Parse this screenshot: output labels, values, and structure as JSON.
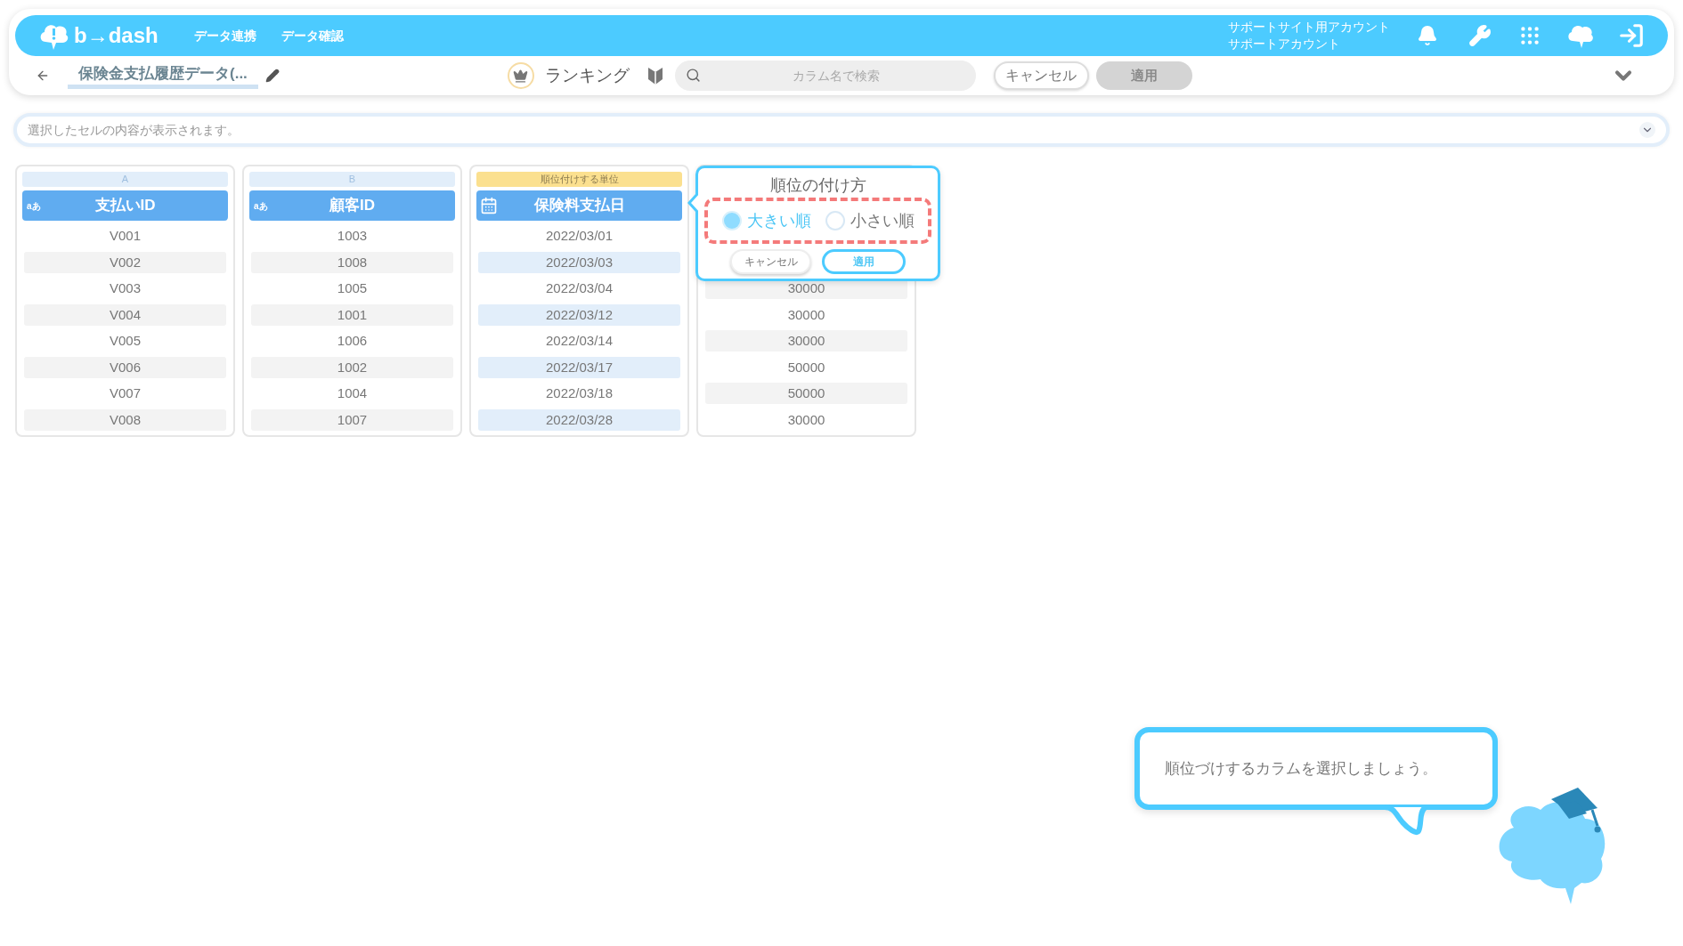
{
  "header": {
    "logo": "b→dash",
    "nav": [
      "データ連携",
      "データ確認"
    ],
    "account": [
      "サポートサイト用アカウント",
      "サポートアカウント"
    ]
  },
  "toolbar": {
    "title": "保険金支払履歴データ(...",
    "mode": "ランキング",
    "search": {
      "placeholder": "カラム名で検索"
    },
    "cancel": "キャンセル",
    "apply": {
      "label": "適用",
      "disabled": true
    }
  },
  "cell_bar": {
    "placeholder": "選択したセルの内容が表示されます。"
  },
  "columns": [
    {
      "kind": "text",
      "letter": "A",
      "type_label": "aあ",
      "name": "支払いID",
      "highlighted": false,
      "values": [
        "V001",
        "V002",
        "V003",
        "V004",
        "V005",
        "V006",
        "V007",
        "V008"
      ]
    },
    {
      "kind": "text",
      "letter": "B",
      "type_label": "aあ",
      "name": "顧客ID",
      "highlighted": false,
      "values": [
        "1003",
        "1008",
        "1005",
        "1001",
        "1006",
        "1002",
        "1004",
        "1007"
      ]
    },
    {
      "kind": "date",
      "letter": "順位付けする単位",
      "name": "保険料支払日",
      "highlighted": true,
      "values": [
        "2022/03/01",
        "2022/03/03",
        "2022/03/04",
        "2022/03/12",
        "2022/03/14",
        "2022/03/17",
        "2022/03/18",
        "2022/03/28"
      ]
    },
    {
      "kind": "covered",
      "highlighted": false,
      "values": [
        "30000",
        "30000",
        "30000",
        "50000",
        "50000",
        "30000"
      ]
    }
  ],
  "popover": {
    "title": "順位の付け方",
    "options": [
      {
        "label": "大きい順",
        "selected": true
      },
      {
        "label": "小さい順",
        "selected": false
      }
    ],
    "cancel": "キャンセル",
    "apply": "適用"
  },
  "guide": {
    "message": "順位づけするカラムを選択しましょう。"
  }
}
